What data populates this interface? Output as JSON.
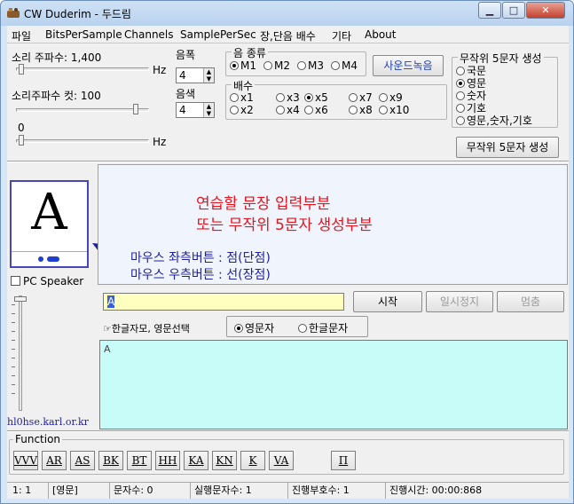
{
  "window": {
    "title": "CW Duderim - 두드림"
  },
  "menu": [
    "파일",
    "BitsPerSample",
    "Channels",
    "SamplePerSec",
    "장,단음 배수",
    "기타",
    "About"
  ],
  "controls": {
    "sound_freq_label": "소리 주파수: 1,400",
    "hz1": "Hz",
    "cutoff_label": "소리주파수 컷: 100",
    "zero": "0",
    "hz2": "Hz",
    "width_label": "음폭",
    "width_value": "4",
    "color_label": "음색",
    "color_value": "4",
    "pc_speaker": "PC Speaker",
    "sound_test_button": "사운드녹음"
  },
  "sound_type": {
    "title": "음 종류",
    "options": [
      "M1",
      "M2",
      "M3",
      "M4"
    ],
    "selected": "M1"
  },
  "multiplier": {
    "title": "배수",
    "row1": [
      "x1",
      "x3",
      "x5",
      "x7",
      "x9"
    ],
    "row2": [
      "x2",
      "x4",
      "x6",
      "x8",
      "x10"
    ],
    "selected": "x5"
  },
  "random_group": {
    "title": "무작위 5문자 생성",
    "options": [
      "국문",
      "영문",
      "숫자",
      "기호",
      "영문,숫자,기호"
    ],
    "selected": "영문",
    "button": "무작위 5문자 생성"
  },
  "display": {
    "letter": "A",
    "link": "hl0hse.karl.or.kr"
  },
  "annotations": {
    "line1": "연습할 문장 입력부분",
    "line2": "또는 무작위 5문자 생성부분",
    "left_click": "마우스 좌측버튼 : 점(단점)",
    "right_click": "마우스 우측버튼 : 선(장점)"
  },
  "input": {
    "value": "A",
    "start": "시작",
    "pause": "일시정지",
    "stop": "멈춤"
  },
  "lang_select": {
    "label": "☞한글자모, 영문선택",
    "options": [
      "영문자",
      "한글문자"
    ],
    "selected": "영문자"
  },
  "output": {
    "value": "A"
  },
  "function": {
    "title": "Function",
    "buttons": [
      "VVV",
      "AR",
      "AS",
      "BK",
      "BT",
      "HH",
      "KA",
      "KN",
      "K",
      "VA",
      "Π"
    ]
  },
  "status": [
    "1: 1",
    "[영문]",
    "문자수: 0",
    "실행문자수: 1",
    "진행부호수: 1",
    "진행시간: 00:00:868"
  ],
  "colors": {
    "annotation_red": "#e8141e",
    "annotation_blue": "#1f1f9e",
    "input_bg": "#ffffc0",
    "output_bg": "#c8fcf8"
  }
}
